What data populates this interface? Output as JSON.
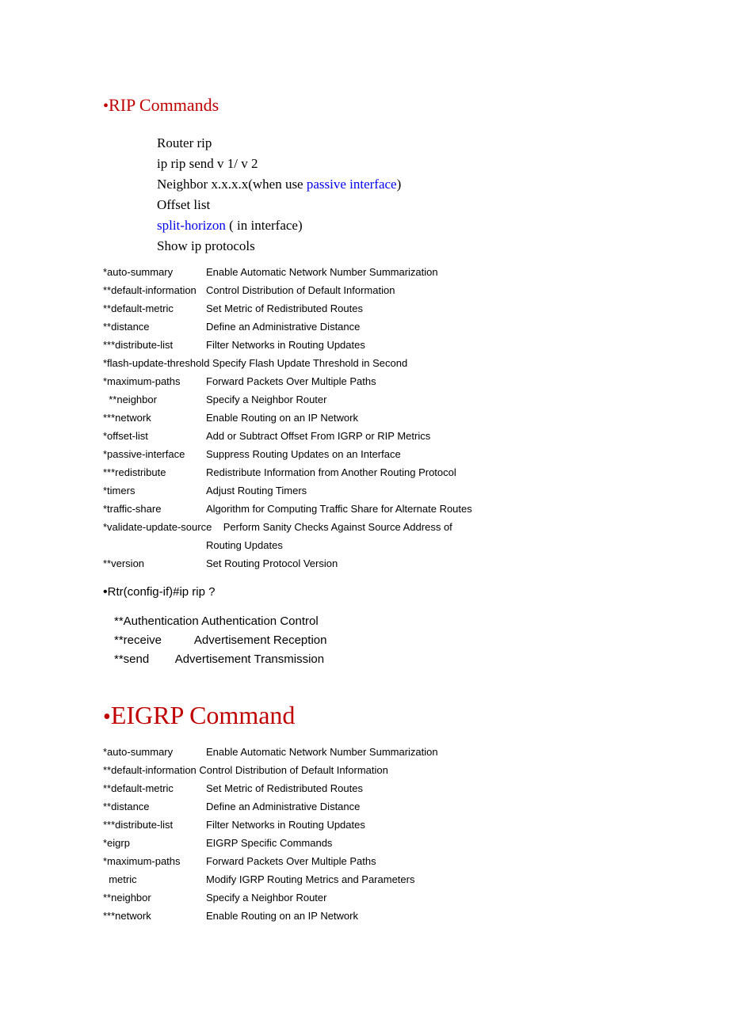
{
  "rip": {
    "heading": "RIP Commands",
    "intro": [
      [
        {
          "t": "Router rip"
        }
      ],
      [
        {
          "t": "ip rip send v 1/ v 2"
        }
      ],
      [
        {
          "t": "Neighbor x.x.x.x(when use "
        },
        {
          "t": "passive interface",
          "link": true
        },
        {
          "t": ")"
        }
      ],
      [
        {
          "t": "Offset list"
        }
      ],
      [
        {
          "t": "split-horizon",
          "link": true
        },
        {
          "t": " ( in interface)"
        }
      ],
      [
        {
          "t": "Show ip protocols"
        }
      ]
    ],
    "commands": [
      {
        "name": "*auto-summary",
        "desc": "Enable Automatic Network Number Summarization"
      },
      {
        "name": "**default-information",
        "desc": "Control Distribution of Default Information"
      },
      {
        "name": "**default-metric",
        "desc": "Set Metric of Redistributed Routes"
      },
      {
        "name": "**distance",
        "desc": "Define an Administrative Distance"
      },
      {
        "name": "***distribute-list",
        "desc": "Filter Networks in Routing Updates"
      },
      {
        "name": "*flash-update-threshold",
        "desc": "Specify Flash Update Threshold in Second",
        "single": true
      },
      {
        "name": "*maximum-paths",
        "desc": "Forward Packets Over Multiple Paths"
      },
      {
        "name": "  **neighbor",
        "desc": "Specify a Neighbor Router"
      },
      {
        "name": "***network",
        "desc": "Enable Routing on an IP Network"
      },
      {
        "name": "*offset-list",
        "desc": "Add or Subtract Offset From IGRP or RIP Metrics"
      },
      {
        "name": "*passive-interface",
        "desc": "Suppress Routing Updates on an Interface"
      },
      {
        "name": "***redistribute",
        "desc": "Redistribute Information from Another Routing  Protocol"
      },
      {
        "name": "*timers",
        "desc": "Adjust Routing Timers"
      },
      {
        "name": "*traffic-share",
        "desc": "Algorithm for Computing Traffic Share for Alternate Routes"
      },
      {
        "name": "*validate-update-source",
        "desc": "Perform Sanity Checks Against Source Address of",
        "single": true,
        "pad": true
      },
      {
        "name": "",
        "desc": "Routing Updates"
      },
      {
        "name": "**version",
        "desc": "Set Routing Protocol Version"
      }
    ],
    "iprip_title": "Rtr(config-if)#ip rip ?",
    "iprip": [
      {
        "line": "**Authentication Authentication Control"
      },
      {
        "line": "**receive          Advertisement Reception"
      },
      {
        "line": "**send        Advertisement Transmission"
      }
    ]
  },
  "eigrp": {
    "heading": "EIGRP Command",
    "commands": [
      {
        "name": "*auto-summary",
        "desc": "Enable Automatic Network Number Summarization"
      },
      {
        "name": "**default-information",
        "desc": "Control Distribution of Default Information",
        "single": true
      },
      {
        "name": "**default-metric",
        "desc": "Set Metric of Redistributed Routes"
      },
      {
        "name": "**distance",
        "desc": "Define an Administrative Distance"
      },
      {
        "name": "***distribute-list",
        "desc": "Filter Networks in Routing Updates"
      },
      {
        "name": "*eigrp",
        "desc": "EIGRP Specific Commands"
      },
      {
        "name": "*maximum-paths",
        "desc": "Forward Packets Over Multiple Paths"
      },
      {
        "name": "  metric",
        "desc": "Modify IGRP Routing Metrics and Parameters"
      },
      {
        "name": "**neighbor",
        "desc": "Specify a Neighbor Router"
      },
      {
        "name": "***network",
        "desc": "Enable Routing on an IP Network"
      }
    ]
  }
}
